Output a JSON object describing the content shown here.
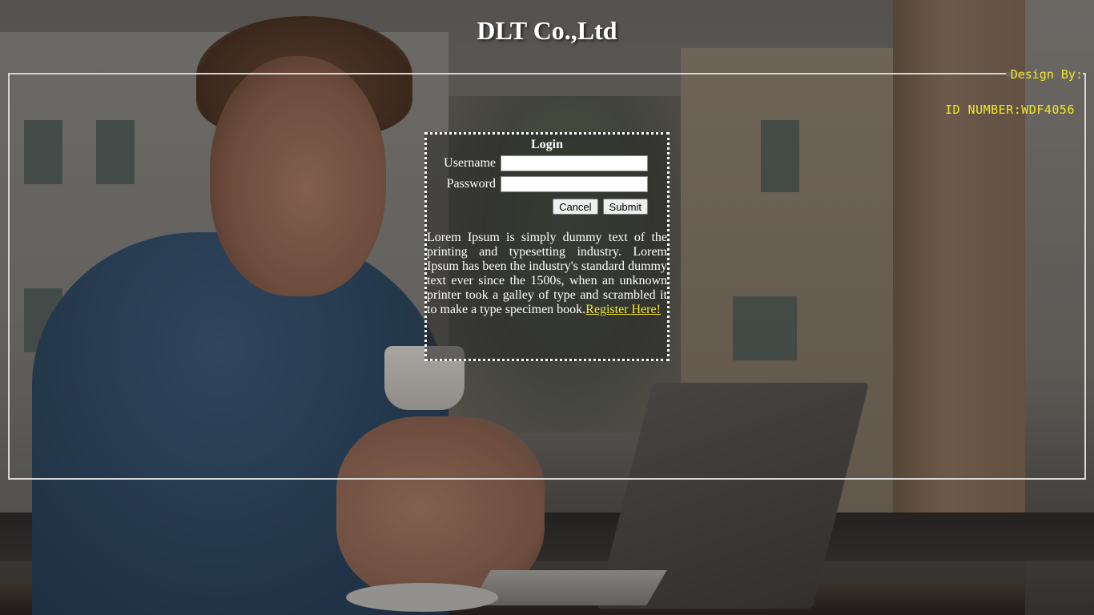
{
  "header": {
    "title": "DLT Co.,Ltd"
  },
  "credits": {
    "design_by": "Design By:",
    "id_number": "ID NUMBER:WDF4056"
  },
  "login": {
    "title": "Login",
    "username_label": "Username",
    "password_label": "Password",
    "username_value": "",
    "password_value": "",
    "cancel_label": "Cancel",
    "submit_label": "Submit",
    "description": "Lorem Ipsum is simply dummy text of the printing and typesetting industry. Lorem Ipsum has been the industry's standard dummy text ever since the 1500s, when an unknown printer took a galley of type and scrambled it to make a type specimen book.",
    "register_link": "Register Here!"
  },
  "colors": {
    "accent_yellow": "#f2e62a",
    "frame_border": "#d6d6d6",
    "title_text": "#ffffff"
  }
}
